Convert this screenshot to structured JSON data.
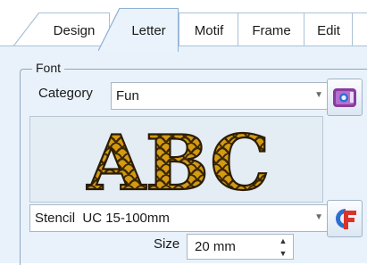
{
  "tabs": [
    {
      "label": "Design",
      "active": false
    },
    {
      "label": "Letter",
      "active": true
    },
    {
      "label": "Motif",
      "active": false
    },
    {
      "label": "Frame",
      "active": false
    },
    {
      "label": "Edit",
      "active": false
    }
  ],
  "font_group": {
    "legend": "Font",
    "category_label": "Category",
    "category_value": "Fun",
    "preview_text": "ABC",
    "font_value": "Stencil  UC 15-100mm",
    "size_label": "Size",
    "size_value": "20 mm"
  },
  "icons": {
    "category_button": "photo-browse-icon",
    "font_button": "custom-font-icon",
    "combo_arrow": "chevron-down-icon",
    "spin_up": "spin-up-icon",
    "spin_down": "spin-down-icon"
  },
  "colors": {
    "panel_bg": "#e9f2fa",
    "tab_border": "#a9c0d9",
    "preview_gold": "#d39a12",
    "preview_dark": "#3c2806",
    "accent_purple": "#8a3c9e",
    "accent_red": "#d8352a",
    "accent_blue": "#2b6fd1"
  }
}
